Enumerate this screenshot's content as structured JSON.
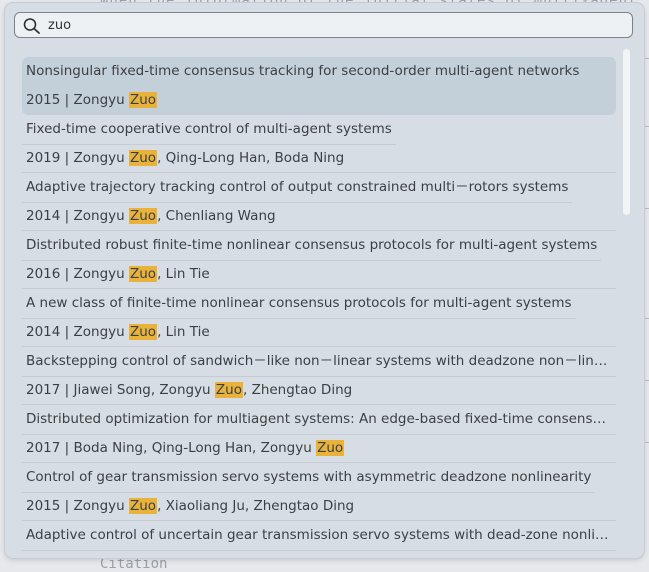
{
  "background": {
    "top_text": "when the information of the initial states of multi-agent",
    "bottom_text": "Citation"
  },
  "search": {
    "icon": "search-icon",
    "value": "zuo",
    "placeholder": ""
  },
  "highlight_color": "#e9b33b",
  "results": [
    {
      "title": "Nonsingular fixed-time consensus tracking for second-order multi-agent networks",
      "year": "2015",
      "authors_before": "Zongyu ",
      "match": "Zuo",
      "authors_after": "",
      "selected": true
    },
    {
      "title": "Fixed-time cooperative control of multi-agent systems",
      "year": "2019",
      "authors_before": "Zongyu ",
      "match": "Zuo",
      "authors_after": ", Qing-Long Han, Boda Ning"
    },
    {
      "title": "Adaptive trajectory tracking control of output constrained multi－rotors systems",
      "year": "2014",
      "authors_before": "Zongyu ",
      "match": "Zuo",
      "authors_after": ", Chenliang Wang"
    },
    {
      "title": "Distributed robust finite-time nonlinear consensus protocols for multi-agent systems",
      "year": "2016",
      "authors_before": "Zongyu ",
      "match": "Zuo",
      "authors_after": ", Lin Tie"
    },
    {
      "title": "A new class of finite-time nonlinear consensus protocols for multi-agent systems",
      "year": "2014",
      "authors_before": "Zongyu ",
      "match": "Zuo",
      "authors_after": ", Lin Tie"
    },
    {
      "title": "Backstepping control of sandwich－like non－linear systems with deadzone non－linea…",
      "year": "2017",
      "authors_before": "Jiawei Song, Zongyu ",
      "match": "Zuo",
      "authors_after": ", Zhengtao Ding"
    },
    {
      "title": "Distributed optimization for multiagent systems: An edge-based fixed-time consensus …",
      "year": "2017",
      "authors_before": "Boda Ning, Qing-Long Han, Zongyu ",
      "match": "Zuo",
      "authors_after": ""
    },
    {
      "title": "Control of gear transmission servo systems with asymmetric deadzone nonlinearity",
      "year": "2015",
      "authors_before": "Zongyu ",
      "match": "Zuo",
      "authors_after": ", Xiaoliang Ju, Zhengtao Ding"
    },
    {
      "title": "Adaptive control of uncertain gear transmission servo systems with dead-zone nonline…",
      "year": "",
      "authors_before": "",
      "match": "",
      "authors_after": ""
    }
  ]
}
